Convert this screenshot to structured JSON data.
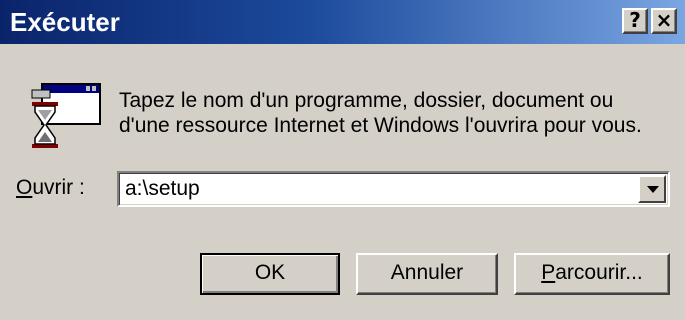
{
  "window": {
    "title": "Exécuter",
    "help_glyph": "?",
    "close_glyph": "×"
  },
  "icon": {
    "name": "run-program-icon"
  },
  "description": {
    "line1": "Tapez le nom d'un programme, dossier, document ou",
    "line2": "d'une ressource Internet et Windows l'ouvrira pour vous."
  },
  "open_field": {
    "label_mnemonic": "O",
    "label_rest": "uvrir :",
    "value": "a:\\setup"
  },
  "buttons": {
    "ok": "OK",
    "cancel": "Annuler",
    "browse_mnemonic": "P",
    "browse_rest": "arcourir..."
  },
  "colors": {
    "title_start": "#0a246a",
    "title_end": "#7aa6e2",
    "face": "#d4d0c8"
  }
}
